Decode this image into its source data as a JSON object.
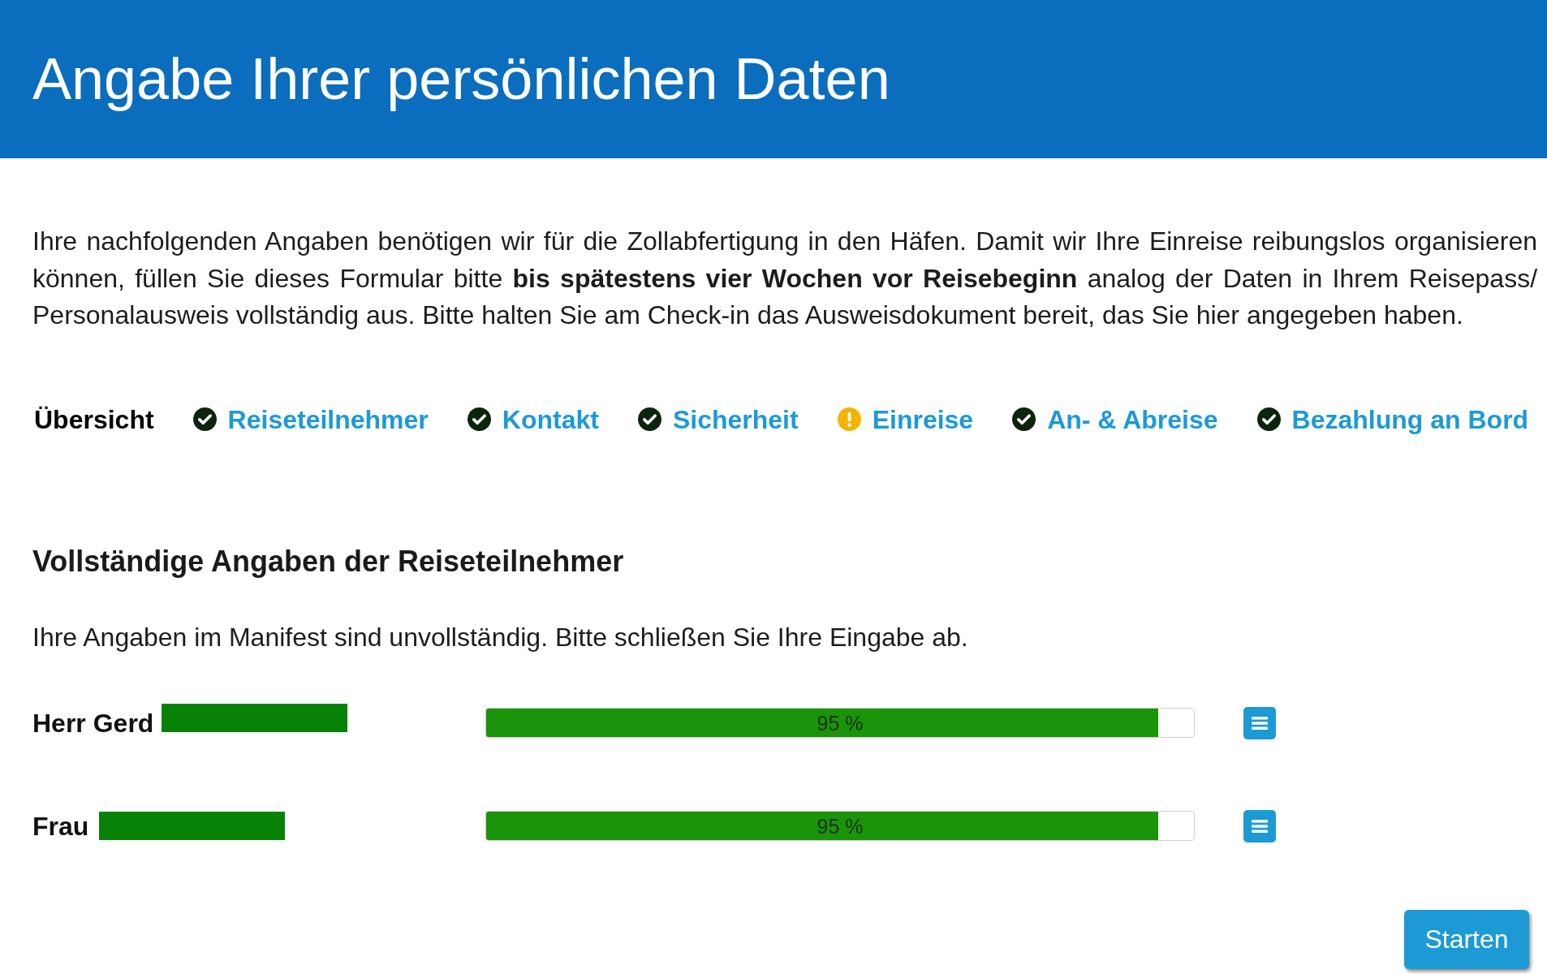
{
  "header": {
    "title": "Angabe Ihrer persönlichen Daten"
  },
  "intro": "Ihre nachfolgenden Angaben benötigen wir für die Zollabfertigung in den Häfen. Damit wir Ihre Einreise reibungslos organisieren können, füllen Sie dieses Formular bitte **bis spätestens vier Wochen vor Reisebeginn** analog der Daten in Ihrem Reisepass/ Personalausweis vollständig aus. Bitte halten Sie am Check-in das Ausweisdokument bereit, das Sie hier angegeben haben.",
  "nav": {
    "title": "Übersicht",
    "items": [
      {
        "label": "Reiseteilnehmer",
        "complete": true
      },
      {
        "label": "Kontakt",
        "complete": true
      },
      {
        "label": "Sicherheit",
        "complete": true
      },
      {
        "label": "Einreise",
        "complete": false
      },
      {
        "label": "An- & Abreise",
        "complete": true
      },
      {
        "label": "Bezahlung an Bord",
        "complete": true
      }
    ]
  },
  "section": {
    "title": "Vollständige Angaben der Reiseteilnehmer",
    "notice": "Ihre Angaben im Manifest sind unvollständig. Bitte schließen Sie Ihre Eingabe ab.",
    "participants": [
      {
        "name": "Herr Gerd",
        "redacted": true,
        "level": 0.95,
        "reading": "95 %"
      },
      {
        "name": "Frau",
        "redacted": true,
        "level": 0.95,
        "reading": "95 %"
      }
    ]
  },
  "buttons": [
    {
      "label": "Starten"
    }
  ]
}
